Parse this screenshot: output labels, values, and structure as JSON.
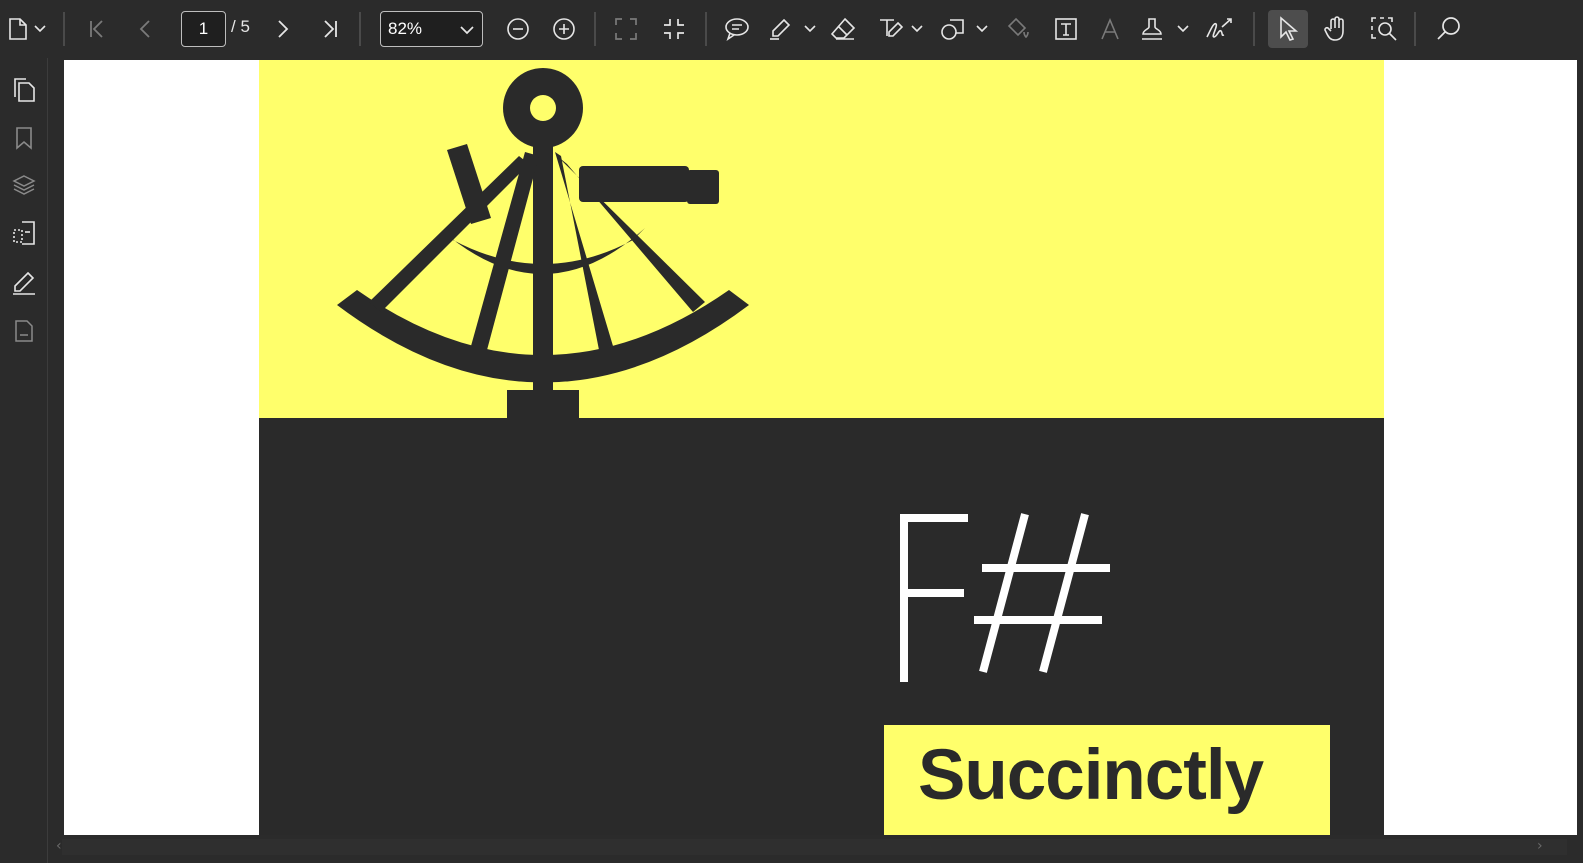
{
  "toolbar": {
    "page_current": "1",
    "page_total": "/ 5",
    "zoom_value": "82%",
    "icons": [
      "file-menu-icon",
      "first-page-icon",
      "previous-page-icon",
      "next-page-icon",
      "last-page-icon",
      "zoom-out-icon",
      "zoom-in-icon",
      "fit-page-icon",
      "collapse-icon",
      "comment-icon",
      "highlight-icon",
      "eraser-icon",
      "text-markup-icon",
      "shape-icon",
      "fill-icon",
      "text-box-icon",
      "font-icon",
      "stamp-icon",
      "signature-icon",
      "select-tool-icon",
      "hand-tool-icon",
      "marquee-zoom-icon",
      "search-icon"
    ]
  },
  "sidebar": {
    "items": [
      "pages-thumbnail-icon",
      "bookmark-icon",
      "layers-icon",
      "page-organize-icon",
      "annotations-icon",
      "attachments-icon"
    ]
  },
  "document": {
    "title_main": "F#",
    "title_sub": "Succinctly",
    "colors": {
      "accent_yellow": "#ffff6b",
      "cover_dark": "#2a2a2a"
    }
  }
}
